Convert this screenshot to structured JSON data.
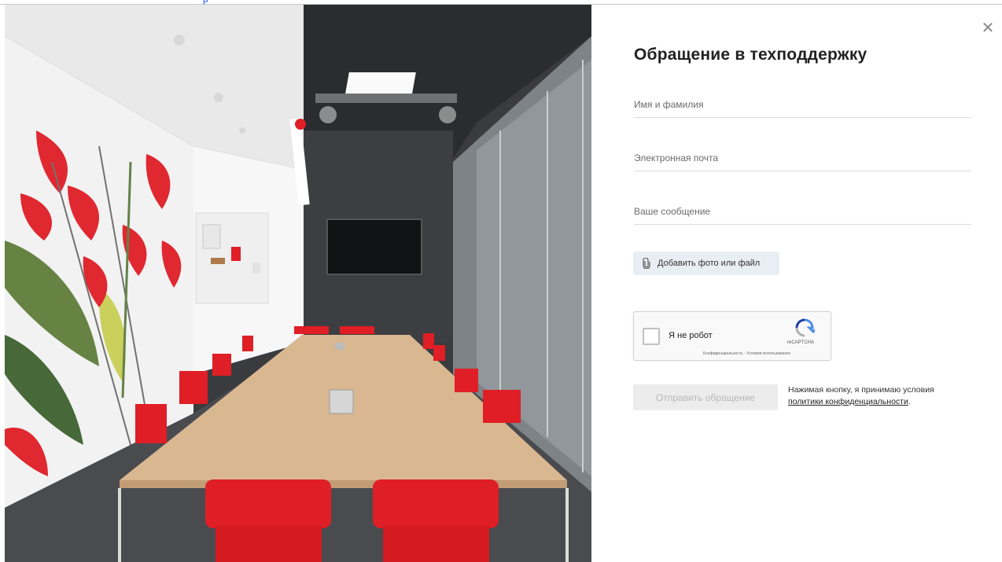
{
  "modal": {
    "title": "Обращение в техподдержку",
    "close_icon": "close-icon",
    "close_glyph": "✕"
  },
  "form": {
    "name_placeholder": "Имя и фамилия",
    "email_placeholder": "Электронная почта",
    "message_placeholder": "Ваше сообщение",
    "attach_label": "Добавить фото или файл",
    "attach_icon": "paperclip-icon",
    "submit_label": "Отправить обращение",
    "terms_prefix": "Нажимая кнопку, я принимаю условия",
    "terms_link": "политики конфиденциальности",
    "terms_suffix": "."
  },
  "captcha": {
    "label": "Я не робот",
    "brand": "reCAPTCHA",
    "links": "Конфиденциальность - Условия использования",
    "logo_icon": "recaptcha-logo-icon"
  },
  "photo": {
    "description_icon": "meeting-room-photo"
  },
  "colors": {
    "chair_red": "#e01e26",
    "attach_bg": "#e9eef4",
    "submit_disabled_bg": "#ececec",
    "submit_disabled_text": "#b8b8b8"
  }
}
